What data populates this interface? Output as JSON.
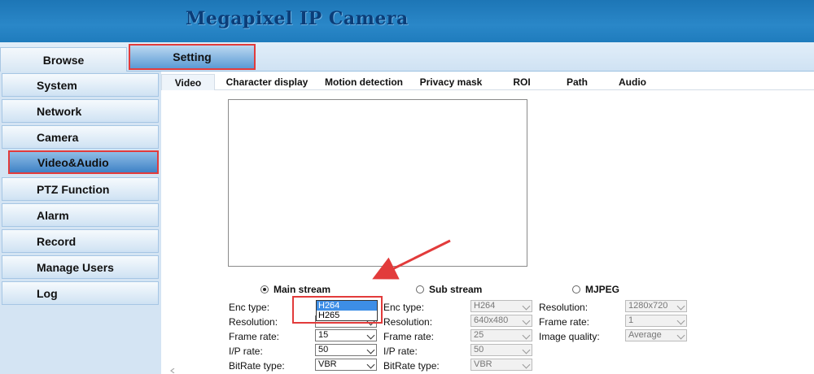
{
  "header": {
    "title": "Megapixel IP Camera"
  },
  "top_tabs": {
    "browse": "Browse",
    "setting": "Setting"
  },
  "sidebar": {
    "items": [
      {
        "label": "System"
      },
      {
        "label": "Network"
      },
      {
        "label": "Camera"
      },
      {
        "label": "Video&Audio"
      },
      {
        "label": "PTZ Function"
      },
      {
        "label": "Alarm"
      },
      {
        "label": "Record"
      },
      {
        "label": "Manage Users"
      },
      {
        "label": "Log"
      }
    ]
  },
  "subtabs": [
    "Video",
    "Character display",
    "Motion detection",
    "Privacy mask",
    "ROI",
    "Path",
    "Audio"
  ],
  "streams": {
    "main": {
      "label": "Main stream",
      "checked": true
    },
    "sub": {
      "label": "Sub stream"
    },
    "mjpeg": {
      "label": "MJPEG"
    }
  },
  "main_stream": {
    "enc_type_label": "Enc type:",
    "resolution_label": "Resolution:",
    "frame_rate_label": "Frame rate:",
    "frame_rate": "15",
    "ip_rate_label": "I/P rate:",
    "ip_rate": "50",
    "bitrate_type_label": "BitRate type:",
    "bitrate_type": "VBR",
    "enc_dropdown_options": [
      "H264",
      "H265"
    ]
  },
  "sub_stream": {
    "enc_type_label": "Enc type:",
    "enc_type": "H264",
    "resolution_label": "Resolution:",
    "resolution": "640x480",
    "frame_rate_label": "Frame rate:",
    "frame_rate": "25",
    "ip_rate_label": "I/P rate:",
    "ip_rate": "50",
    "bitrate_type_label": "BitRate type:",
    "bitrate_type": "VBR"
  },
  "mjpeg_stream": {
    "resolution_label": "Resolution:",
    "resolution": "1280x720",
    "frame_rate_label": "Frame rate:",
    "frame_rate": "1",
    "image_quality_label": "Image quality:",
    "image_quality": "Average"
  },
  "colors": {
    "header_blue": "#1d76b6",
    "highlight_red": "#e23b3b",
    "active_blue": "#3f82c6",
    "title_navy": "#0b3d78"
  }
}
